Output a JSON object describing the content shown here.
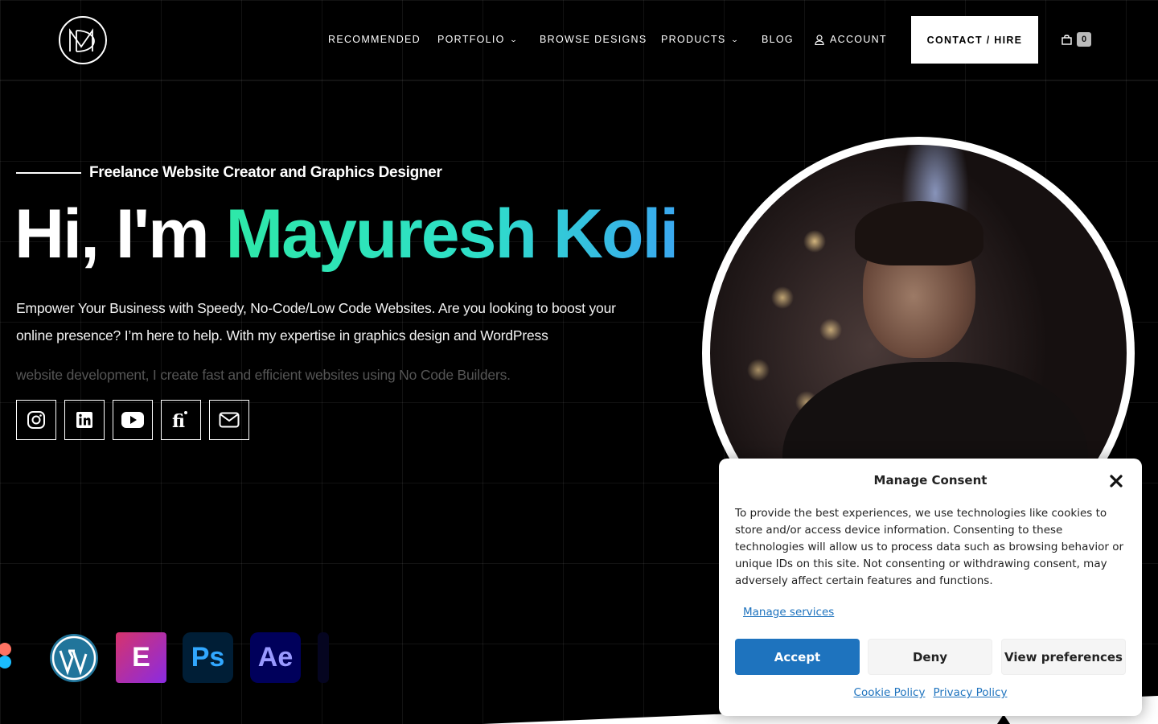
{
  "nav": {
    "items": [
      {
        "label": "RECOMMENDED"
      },
      {
        "label": "PORTFOLIO"
      },
      {
        "label": "BROWSE DESIGNS"
      },
      {
        "label": "PRODUCTS"
      },
      {
        "label": "BLOG"
      },
      {
        "label": "ACCOUNT"
      }
    ],
    "contact_label": "CONTACT / HIRE",
    "cart_count": "0"
  },
  "hero": {
    "tagline": "Freelance Website Creator and Graphics Designer",
    "greeting": "Hi, I'm ",
    "name": "Mayuresh Koli",
    "description": "Empower Your Business with Speedy, No-Code/Low Code Websites. Are you looking to boost your online presence? I’m here to help. With my expertise in graphics design and WordPress",
    "description_faded": "website development, I create fast and efficient websites using No Code Builders."
  },
  "socials": [
    "instagram-icon",
    "linkedin-icon",
    "youtube-icon",
    "fiverr-icon",
    "mail-icon"
  ],
  "tools": {
    "elementor": "E",
    "photoshop": "Ps",
    "aftereffects": "Ae"
  },
  "consent": {
    "title": "Manage Consent",
    "text": "To provide the best experiences, we use technologies like cookies to store and/or access device information. Consenting to these technologies will allow us to process data such as browsing behavior or unique IDs on this site. Not consenting or withdrawing consent, may adversely affect certain features and functions.",
    "manage_services": "Manage services",
    "accept": "Accept",
    "deny": "Deny",
    "view_preferences": "View preferences",
    "cookie_policy": "Cookie Policy",
    "privacy_policy": "Privacy Policy"
  },
  "colors": {
    "accent_gradient_start": "#2ee8a8",
    "accent_gradient_end": "#3aa8f0",
    "accept_button": "#1e73be"
  }
}
